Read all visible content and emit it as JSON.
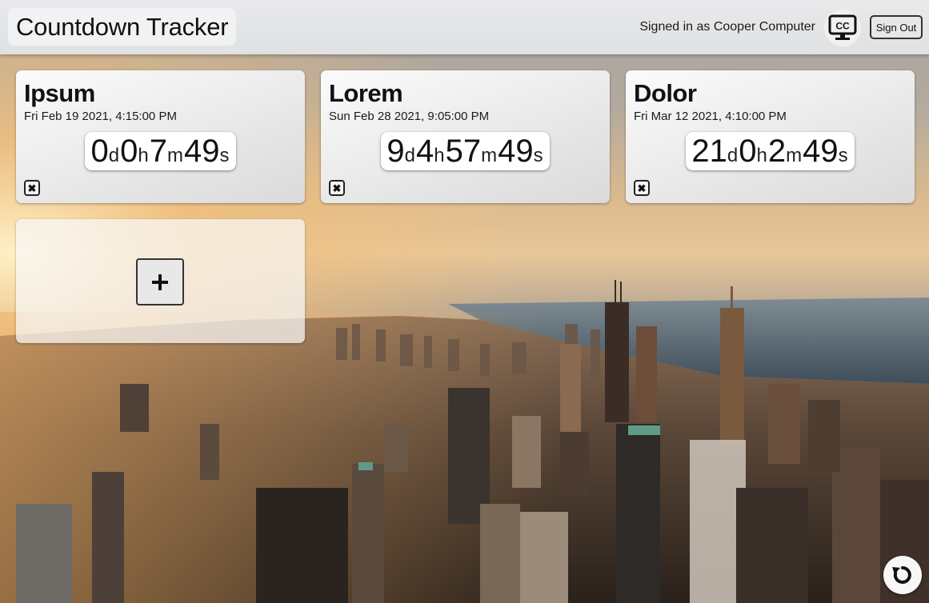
{
  "app": {
    "title": "Countdown Tracker",
    "signed_in_text": "Signed in as Cooper Computer",
    "avatar_icon": "monitor-cc-icon",
    "avatar_initials": "CC",
    "sign_out_label": "Sign Out"
  },
  "countdowns": [
    {
      "name": "Ipsum",
      "date": "Fri Feb 19 2021, 4:15:00 PM",
      "days": "0",
      "hours": "0",
      "minutes": "7",
      "seconds": "49"
    },
    {
      "name": "Lorem",
      "date": "Sun Feb 28 2021, 9:05:00 PM",
      "days": "9",
      "hours": "4",
      "minutes": "57",
      "seconds": "49"
    },
    {
      "name": "Dolor",
      "date": "Fri Mar 12 2021, 4:10:00 PM",
      "days": "21",
      "hours": "0",
      "minutes": "2",
      "seconds": "49"
    }
  ],
  "units": {
    "d": "d",
    "h": "h",
    "m": "m",
    "s": "s"
  },
  "icons": {
    "delete": "close-icon",
    "add": "plus-icon",
    "refresh": "refresh-icon"
  },
  "delete_glyph": "✖",
  "colors": {
    "header_bg": "#e3e5e6",
    "card_bg": "#f0f0f0",
    "text": "#111111"
  }
}
